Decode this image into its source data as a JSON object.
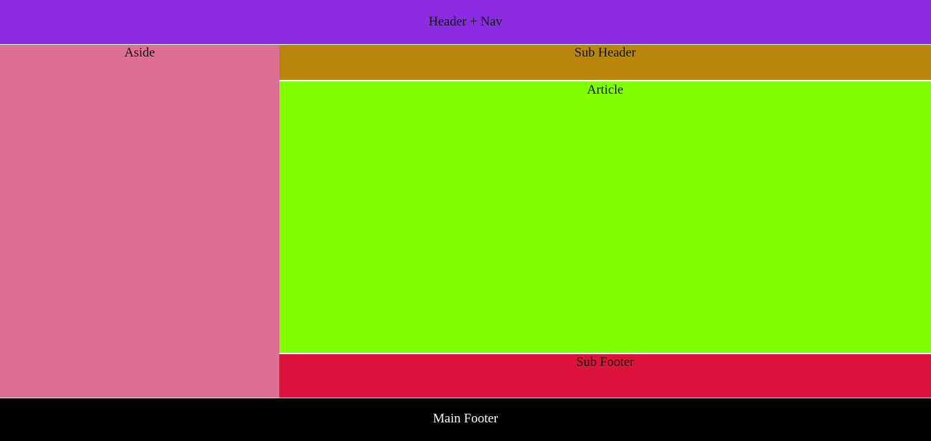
{
  "header": {
    "label": "Header + Nav"
  },
  "aside": {
    "label": "Aside"
  },
  "sub_header": {
    "label": "Sub Header"
  },
  "article": {
    "label": "Article"
  },
  "sub_footer": {
    "label": "Sub Footer"
  },
  "footer": {
    "label": "Main Footer"
  },
  "colors": {
    "header": "#8a2be2",
    "aside": "#db7093",
    "sub_header": "#b8860b",
    "article": "#7fff00",
    "sub_footer": "#dc143c",
    "footer": "#000000"
  }
}
